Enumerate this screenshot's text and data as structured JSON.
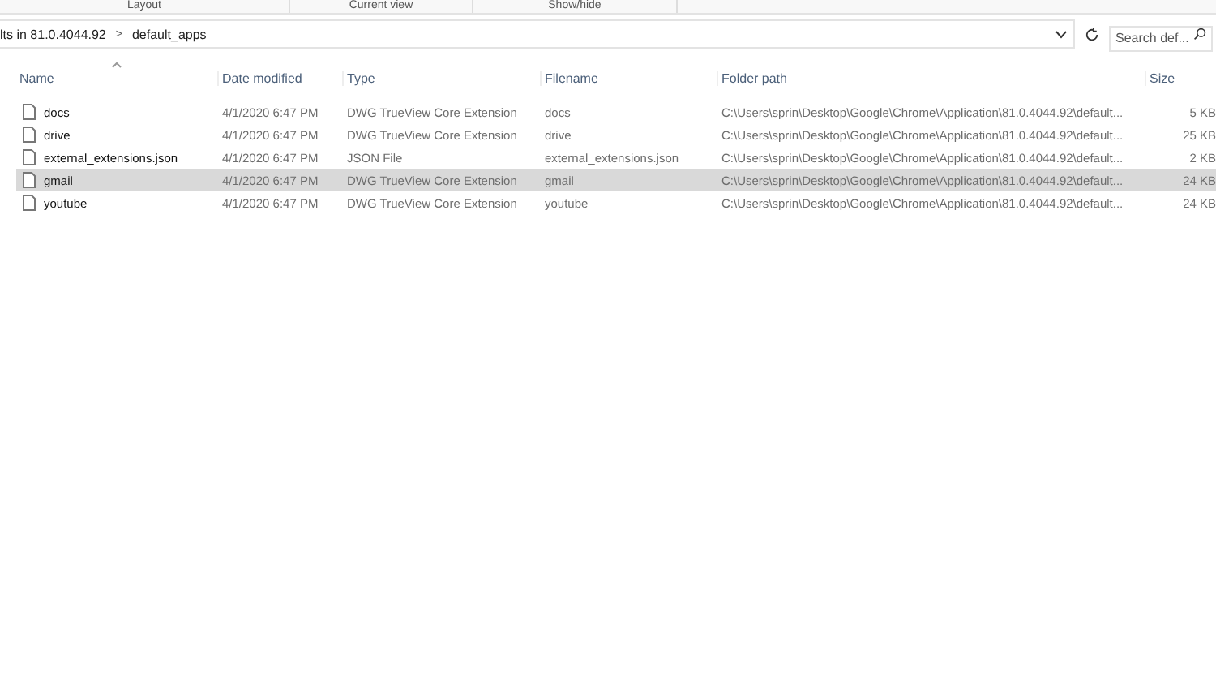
{
  "ribbon_groups": [
    "Layout",
    "Current view",
    "Show/hide"
  ],
  "address": {
    "crumbs": [
      "lts in 81.0.4044.92",
      "default_apps"
    ],
    "separator": ">"
  },
  "search": {
    "placeholder": "Search def..."
  },
  "table": {
    "columns": [
      "Name",
      "Date modified",
      "Type",
      "Filename",
      "Folder path",
      "Size"
    ],
    "rows": [
      {
        "name": "docs",
        "date": "4/1/2020 6:47 PM",
        "type": "DWG TrueView Core Extension",
        "filename": "docs",
        "path": "C:\\Users\\sprin\\Desktop\\Google\\Chrome\\Application\\81.0.4044.92\\default...",
        "size": "5 KB",
        "selected": false
      },
      {
        "name": "drive",
        "date": "4/1/2020 6:47 PM",
        "type": "DWG TrueView Core Extension",
        "filename": "drive",
        "path": "C:\\Users\\sprin\\Desktop\\Google\\Chrome\\Application\\81.0.4044.92\\default...",
        "size": "25 KB",
        "selected": false
      },
      {
        "name": "external_extensions.json",
        "date": "4/1/2020 6:47 PM",
        "type": "JSON File",
        "filename": "external_extensions.json",
        "path": "C:\\Users\\sprin\\Desktop\\Google\\Chrome\\Application\\81.0.4044.92\\default...",
        "size": "2 KB",
        "selected": false
      },
      {
        "name": "gmail",
        "date": "4/1/2020 6:47 PM",
        "type": "DWG TrueView Core Extension",
        "filename": "gmail",
        "path": "C:\\Users\\sprin\\Desktop\\Google\\Chrome\\Application\\81.0.4044.92\\default...",
        "size": "24 KB",
        "selected": true
      },
      {
        "name": "youtube",
        "date": "4/1/2020 6:47 PM",
        "type": "DWG TrueView Core Extension",
        "filename": "youtube",
        "path": "C:\\Users\\sprin\\Desktop\\Google\\Chrome\\Application\\81.0.4044.92\\default...",
        "size": "24 KB",
        "selected": false
      }
    ]
  }
}
